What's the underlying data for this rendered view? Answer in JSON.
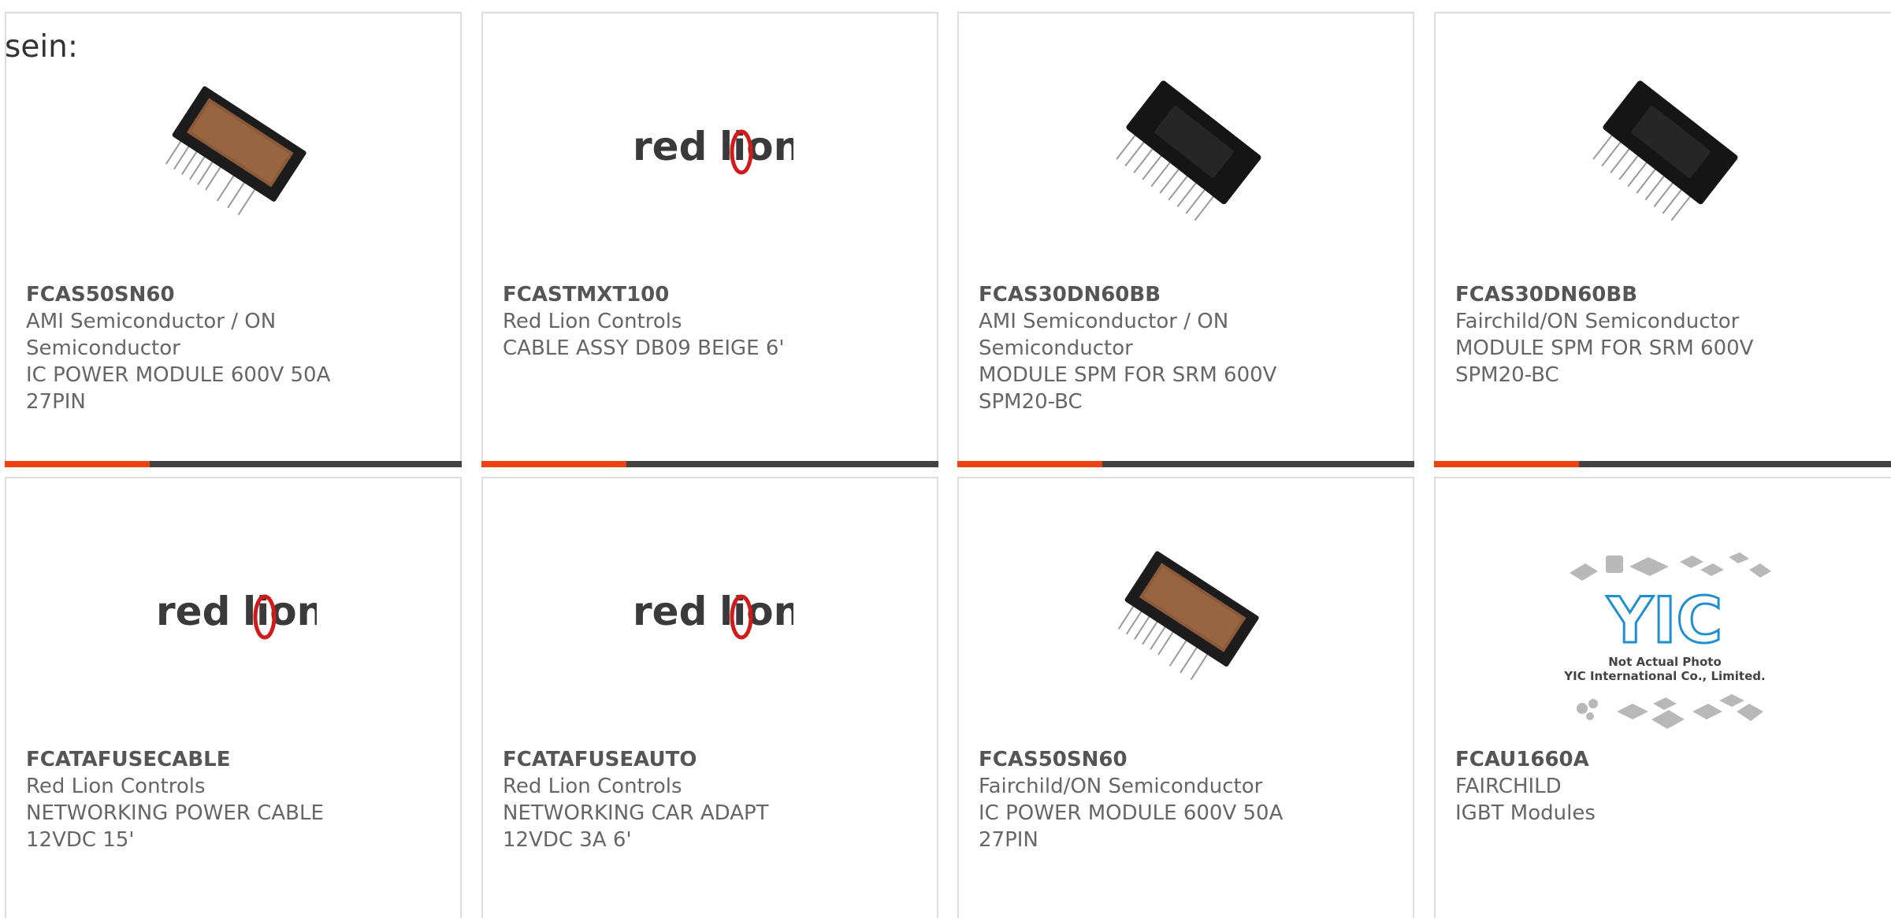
{
  "intro_text": "sein:",
  "colors": {
    "accent": "#ee4311",
    "bar": "#424242",
    "text": "#666666",
    "border": "#dddddd"
  },
  "products": [
    {
      "part": "FCAS50SN60",
      "lines": [
        "AMI Semiconductor / ON",
        "Semiconductor",
        "IC POWER MODULE 600V 50A",
        "27PIN"
      ],
      "image": "power-module-photo"
    },
    {
      "part": "FCASTMXT100",
      "lines": [
        "Red Lion Controls",
        "CABLE ASSY DB09 BEIGE 6'"
      ],
      "image": "red-lion-logo"
    },
    {
      "part": "FCAS30DN60BB",
      "lines": [
        "AMI Semiconductor / ON",
        "Semiconductor",
        "MODULE SPM FOR SRM 600V",
        "SPM20-BC"
      ],
      "image": "spm-module-photo"
    },
    {
      "part": "FCAS30DN60BB",
      "lines": [
        "Fairchild/ON Semiconductor",
        "MODULE SPM FOR SRM 600V",
        "SPM20-BC"
      ],
      "image": "spm-module-photo"
    },
    {
      "part": "FCATAFUSECABLE",
      "lines": [
        "Red Lion Controls",
        "NETWORKING POWER CABLE",
        "12VDC 15'"
      ],
      "image": "red-lion-logo"
    },
    {
      "part": "FCATAFUSEAUTO",
      "lines": [
        "Red Lion Controls",
        "NETWORKING CAR ADAPT",
        "12VDC 3A 6'"
      ],
      "image": "red-lion-logo"
    },
    {
      "part": "FCAS50SN60",
      "lines": [
        "Fairchild/ON Semiconductor",
        "IC POWER MODULE 600V 50A",
        "27PIN"
      ],
      "image": "power-module-photo"
    },
    {
      "part": "FCAU1660A",
      "lines": [
        "FAIRCHILD",
        "IGBT Modules"
      ],
      "image": "placeholder-photo"
    }
  ],
  "logo": {
    "word1": "red",
    "word2": "lion"
  },
  "placeholder": {
    "line1": "Not Actual Photo",
    "line2": "YIC International Co., Limited.",
    "brand": "YIC"
  }
}
